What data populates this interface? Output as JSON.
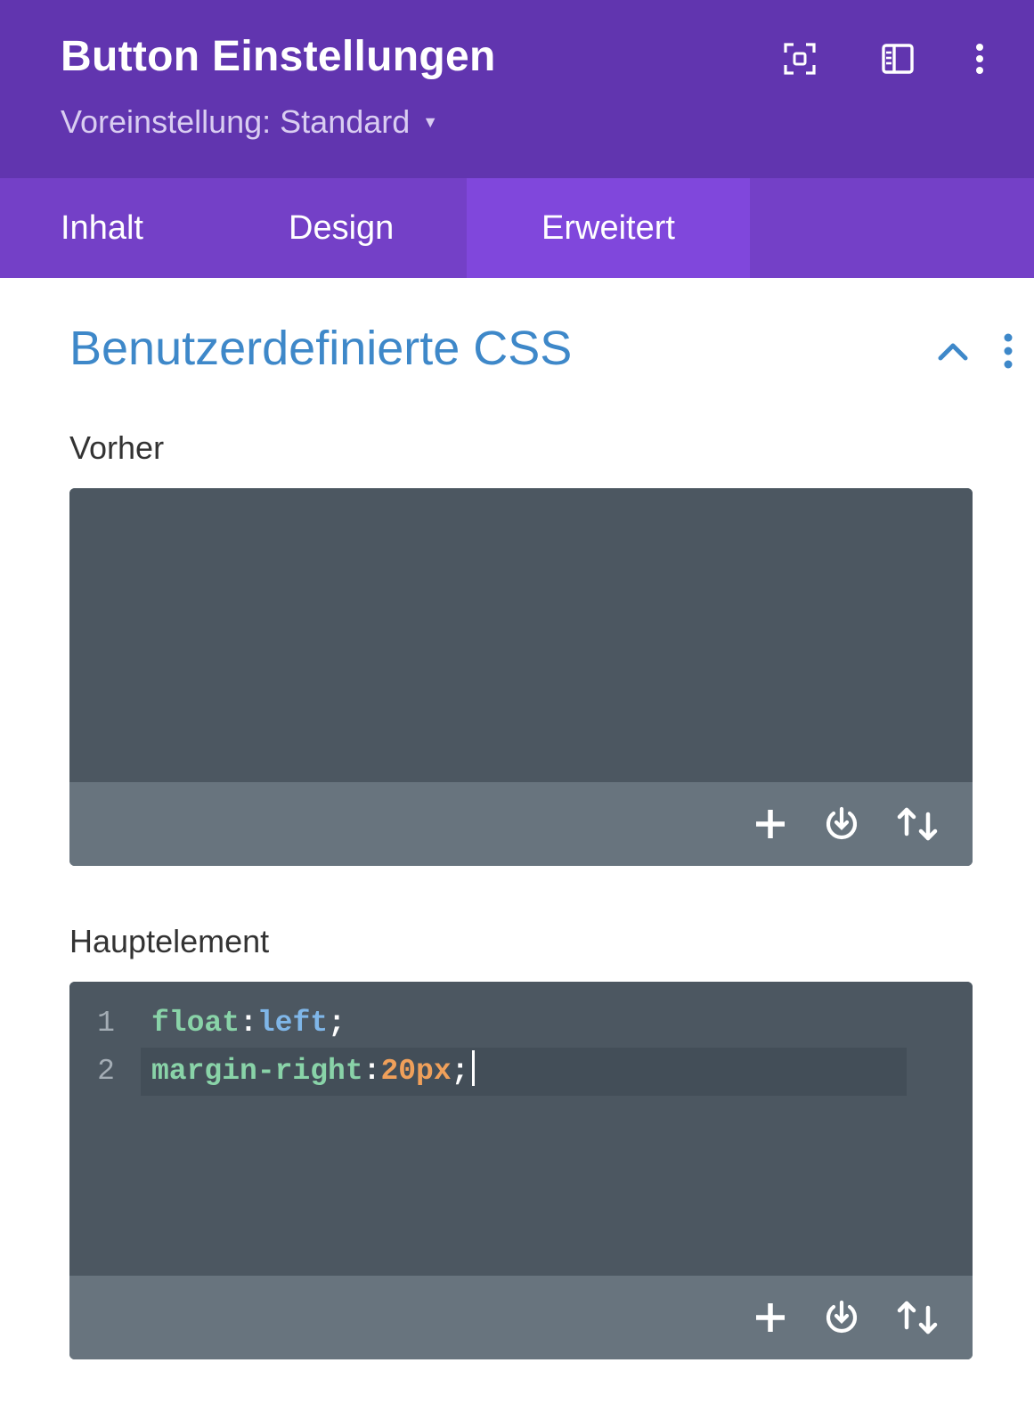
{
  "header": {
    "title": "Button Einstellungen",
    "preset_label": "Voreinstellung: Standard",
    "icons": [
      "expand-icon",
      "sidebar-layout-icon",
      "more-vertical-icon"
    ]
  },
  "tabs": [
    {
      "label": "Inhalt",
      "active": false
    },
    {
      "label": "Design",
      "active": false
    },
    {
      "label": "Erweitert",
      "active": true
    }
  ],
  "section": {
    "title": "Benutzerdefinierte CSS",
    "expanded": true
  },
  "fields": {
    "before": {
      "label": "Vorher",
      "code_lines": []
    },
    "main": {
      "label": "Hauptelement",
      "code_lines": [
        {
          "number": "1",
          "property": "float",
          "colon": ":",
          "value": "left",
          "semicolon": ";"
        },
        {
          "number": "2",
          "property": "margin-right",
          "colon": ":",
          "value": "20px",
          "semicolon": ";"
        }
      ]
    }
  },
  "editor_toolbar_icons": [
    "plus-icon",
    "power-icon",
    "sort-arrows-icon"
  ],
  "colors": {
    "header_bg": "#6135af",
    "tabs_bg": "#7440c7",
    "active_tab_bg": "#8047dc",
    "section_title": "#3e88c9",
    "editor_bg": "#4c5761",
    "editor_footer_bg": "#68747e"
  }
}
